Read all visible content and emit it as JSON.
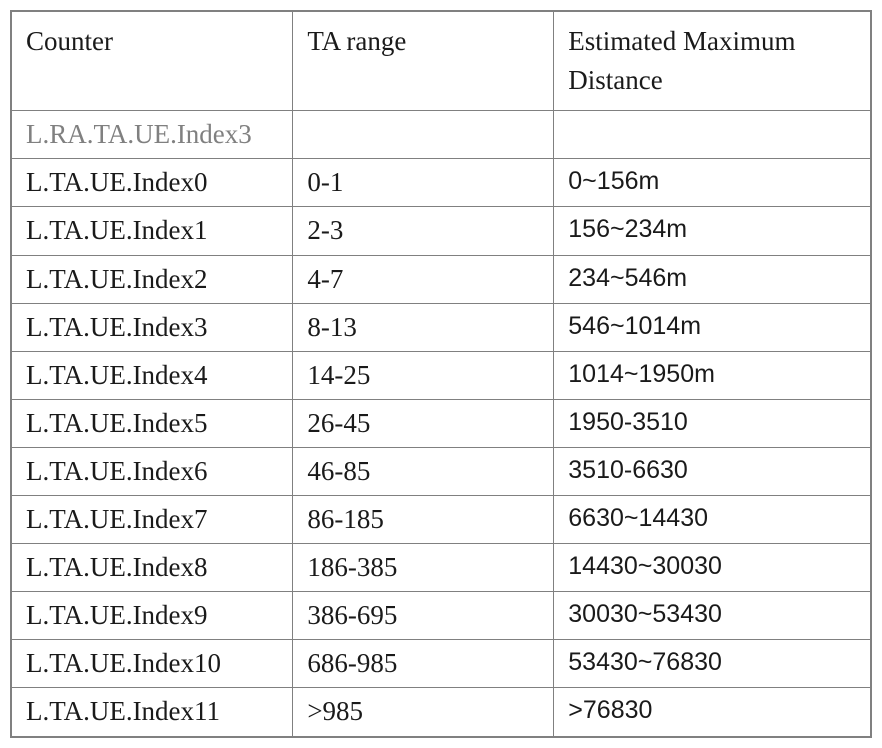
{
  "headers": {
    "col1": "Counter",
    "col2": "TA range",
    "col3": "Estimated Maximum Distance"
  },
  "dim_row": {
    "counter": "L.RA.TA.UE.Index3",
    "ta": "",
    "dist": ""
  },
  "rows": [
    {
      "counter": "L.TA.UE.Index0",
      "ta": "0-1",
      "dist": "0~156m"
    },
    {
      "counter": "L.TA.UE.Index1",
      "ta": "2-3",
      "dist": "156~234m"
    },
    {
      "counter": "L.TA.UE.Index2",
      "ta": "4-7",
      "dist": "234~546m"
    },
    {
      "counter": "L.TA.UE.Index3",
      "ta": "8-13",
      "dist": "546~1014m"
    },
    {
      "counter": "L.TA.UE.Index4",
      "ta": "14-25",
      "dist": "1014~1950m"
    },
    {
      "counter": "L.TA.UE.Index5",
      "ta": "26-45",
      "dist": "1950-3510"
    },
    {
      "counter": "L.TA.UE.Index6",
      "ta": "46-85",
      "dist": "3510-6630"
    },
    {
      "counter": "L.TA.UE.Index7",
      "ta": "86-185",
      "dist": "6630~14430"
    },
    {
      "counter": "L.TA.UE.Index8",
      "ta": "186-385",
      "dist": "14430~30030"
    },
    {
      "counter": "L.TA.UE.Index9",
      "ta": "386-695",
      "dist": "30030~53430"
    },
    {
      "counter": "L.TA.UE.Index10",
      "ta": "686-985",
      "dist": "53430~76830"
    },
    {
      "counter": "L.TA.UE.Index11",
      "ta": ">985",
      "dist": ">76830"
    }
  ],
  "chart_data": {
    "type": "table",
    "columns": [
      "Counter",
      "TA range",
      "Estimated Maximum Distance"
    ],
    "rows": [
      [
        "L.RA.TA.UE.Index3",
        "",
        ""
      ],
      [
        "L.TA.UE.Index0",
        "0-1",
        "0~156m"
      ],
      [
        "L.TA.UE.Index1",
        "2-3",
        "156~234m"
      ],
      [
        "L.TA.UE.Index2",
        "4-7",
        "234~546m"
      ],
      [
        "L.TA.UE.Index3",
        "8-13",
        "546~1014m"
      ],
      [
        "L.TA.UE.Index4",
        "14-25",
        "1014~1950m"
      ],
      [
        "L.TA.UE.Index5",
        "26-45",
        "1950-3510"
      ],
      [
        "L.TA.UE.Index6",
        "46-85",
        "3510-6630"
      ],
      [
        "L.TA.UE.Index7",
        "86-185",
        "6630~14430"
      ],
      [
        "L.TA.UE.Index8",
        "186-385",
        "14430~30030"
      ],
      [
        "L.TA.UE.Index9",
        "386-695",
        "30030~53430"
      ],
      [
        "L.TA.UE.Index10",
        "686-985",
        "53430~76830"
      ],
      [
        "L.TA.UE.Index11",
        ">985",
        ">76830"
      ]
    ]
  }
}
